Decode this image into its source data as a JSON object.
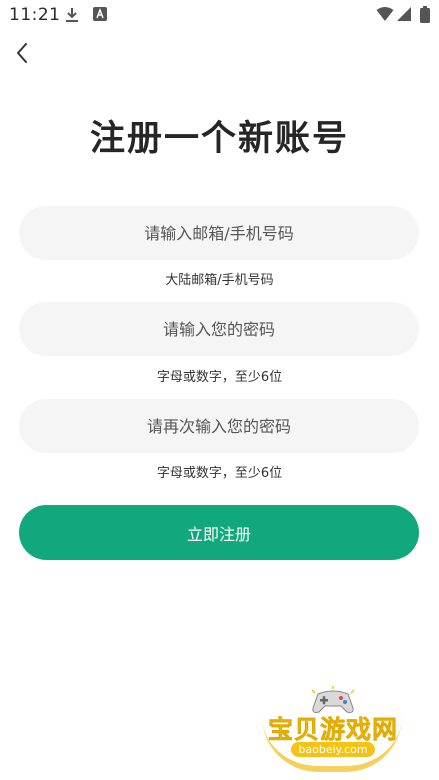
{
  "status_bar": {
    "time": "11:21",
    "icons": [
      "download-icon",
      "a-icon",
      "wifi-icon",
      "signal-icon",
      "battery-icon"
    ]
  },
  "header": {
    "back_icon": "chevron-left-icon",
    "title": "注册一个新账号"
  },
  "form": {
    "account": {
      "placeholder": "请输入邮箱/手机号码",
      "value": "",
      "hint": "大陆邮箱/手机号码"
    },
    "password": {
      "placeholder": "请输入您的密码",
      "value": "",
      "hint": "字母或数字，至少6位"
    },
    "confirm_password": {
      "placeholder": "请再次输入您的密码",
      "value": "",
      "hint": "字母或数字，至少6位"
    },
    "submit_label": "立即注册"
  },
  "watermark": {
    "text": "宝贝游戏网",
    "url": "baobeiy.com"
  },
  "colors": {
    "accent": "#12a87d",
    "field_bg": "#f5f5f5",
    "title": "#262626",
    "watermark": "#f3c315"
  }
}
